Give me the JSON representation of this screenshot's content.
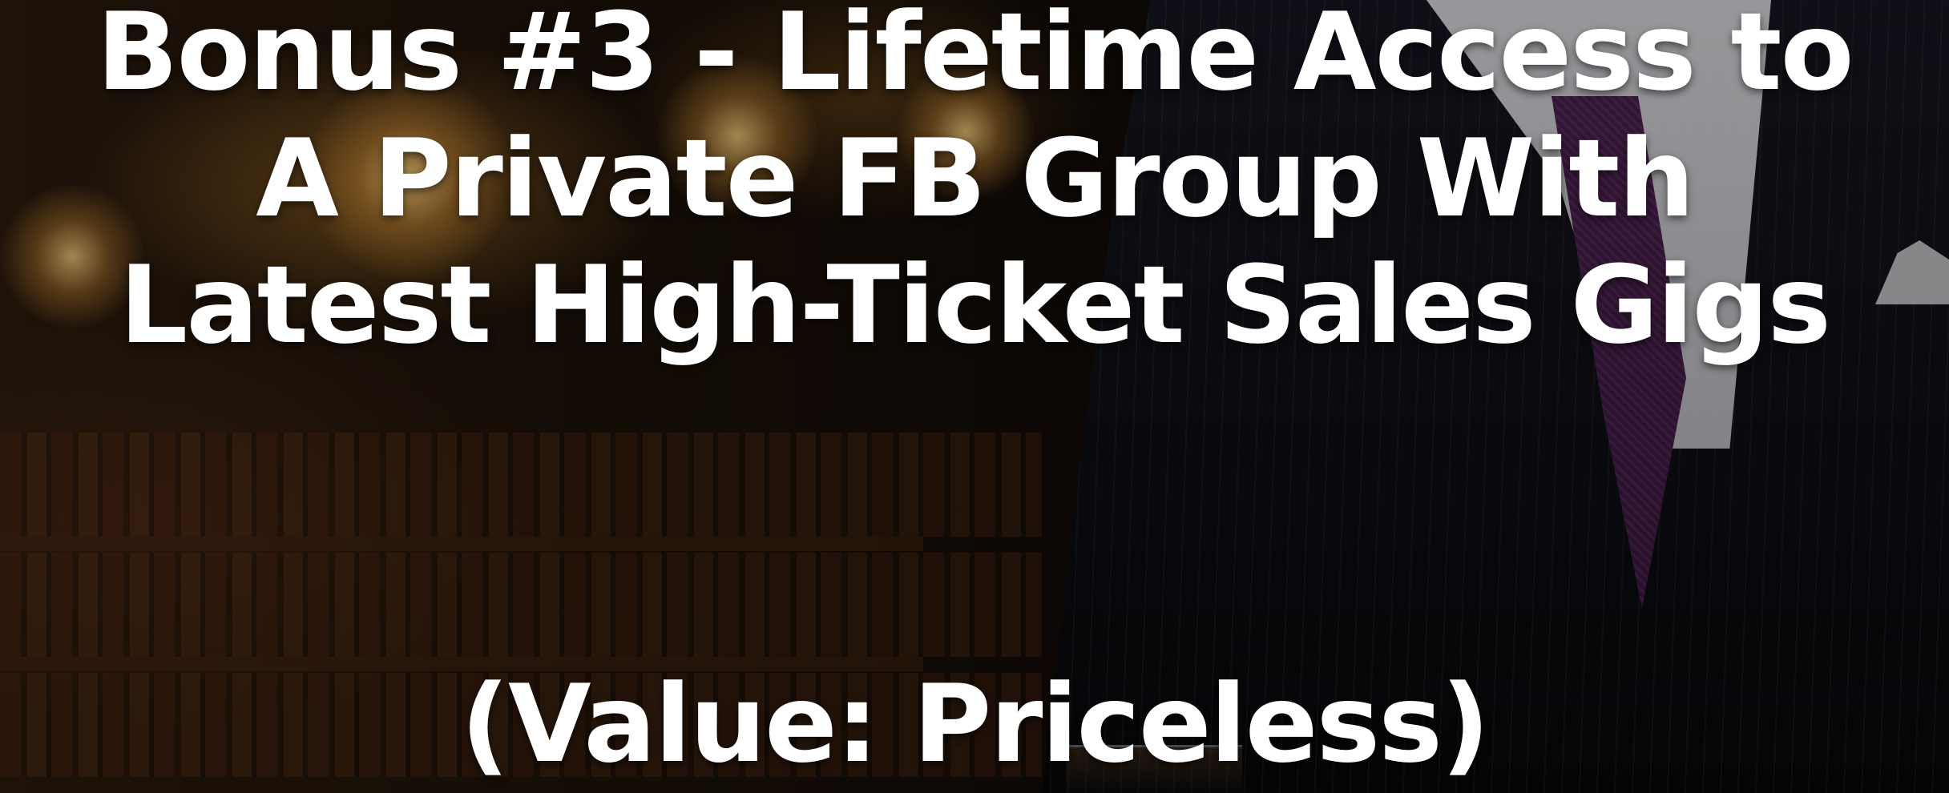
{
  "slide": {
    "headline_lines": [
      "Bonus #3 - Lifetime Access to",
      "A Private FB Group With",
      "Latest High-Ticket Sales Gigs"
    ],
    "value_text": "(Value: Priceless)"
  },
  "colors": {
    "text": "#ffffff",
    "background_warm": "#2a1a0d",
    "background_dark": "#0b0b0d",
    "tie": "#4a1f4e"
  }
}
